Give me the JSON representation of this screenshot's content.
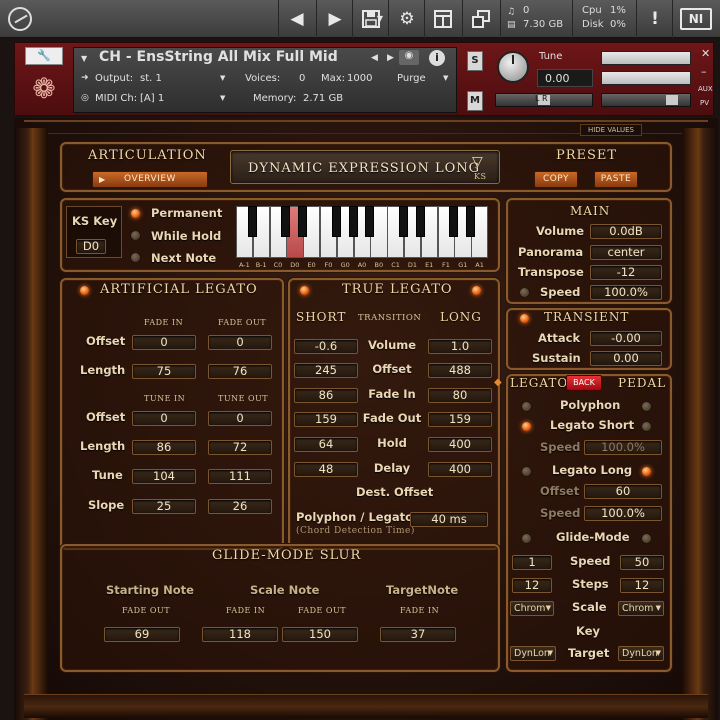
{
  "toolbar": {
    "voices_count": "0",
    "memory": "7.30 GB",
    "cpu_label": "Cpu",
    "cpu_value": "1%",
    "disk_label": "Disk",
    "disk_value": "0%",
    "ni_label": "NI"
  },
  "instrument": {
    "name": "CH - EnsString All Mix Full Mid",
    "output_label": "Output:",
    "output_value": "st. 1",
    "voices_label": "Voices:",
    "voices_value": "0",
    "max_label": "Max:",
    "max_value": "1000",
    "midi_label": "MIDI Ch:",
    "midi_value": "[A]  1",
    "memory_label": "Memory:",
    "memory_value": "2.71 GB",
    "purge_label": "Purge",
    "solo_label": "S",
    "mute_label": "M",
    "tune_label": "Tune",
    "tune_value": "0.00",
    "aux_label": "AUX",
    "pv_label": "PV",
    "lr_label": "L R",
    "hide_values_label": "HIDE VALUES"
  },
  "articulation": {
    "title": "ARTICULATION",
    "overview_button": "OVERVIEW",
    "current": "DYNAMIC EXPRESSION LONG",
    "ks_label": "KS"
  },
  "preset": {
    "title": "PRESET",
    "copy_button": "COPY",
    "paste_button": "PASTE"
  },
  "keyswitch": {
    "ks_key_label": "KS Key",
    "ks_key_value": "D0",
    "modes": [
      {
        "label": "Permanent",
        "on": true
      },
      {
        "label": "While Hold",
        "on": false
      },
      {
        "label": "Next Note",
        "on": false
      }
    ],
    "note_labels": [
      "A-1",
      "B-1",
      "C0",
      "D0",
      "E0",
      "F0",
      "G0",
      "A0",
      "B0",
      "C1",
      "D1",
      "E1",
      "F1",
      "G1",
      "A1"
    ],
    "highlighted_note": "D0"
  },
  "main": {
    "title": "MAIN",
    "rows": [
      {
        "label": "Volume",
        "value": "0.0dB"
      },
      {
        "label": "Panorama",
        "value": "center"
      },
      {
        "label": "Transpose",
        "value": "-12"
      },
      {
        "label": "Speed",
        "value": "100.0%"
      }
    ]
  },
  "transient": {
    "title": "TRANSIENT",
    "attack_label": "Attack",
    "attack_value": "-0.00",
    "sustain_label": "Sustain",
    "sustain_value": "0.00"
  },
  "artificial_legato": {
    "title": "ARTIFICIAL LEGATO",
    "fade_in_header": "FADE IN",
    "fade_out_header": "FADE OUT",
    "tune_in_header": "TUNE IN",
    "tune_out_header": "TUNE OUT",
    "fade_rows": [
      {
        "label": "Offset",
        "in": "0",
        "out": "0"
      },
      {
        "label": "Length",
        "in": "75",
        "out": "76"
      }
    ],
    "tune_rows": [
      {
        "label": "Offset",
        "in": "0",
        "out": "0"
      },
      {
        "label": "Length",
        "in": "86",
        "out": "72"
      },
      {
        "label": "Tune",
        "in": "104",
        "out": "111"
      },
      {
        "label": "Slope",
        "in": "25",
        "out": "26"
      }
    ]
  },
  "true_legato": {
    "title": "TRUE LEGATO",
    "short_header": "SHORT",
    "transition_header": "TRANSITION",
    "long_header": "LONG",
    "rows": [
      {
        "short": "-0.6",
        "label": "Volume",
        "long": "1.0"
      },
      {
        "short": "245",
        "label": "Offset",
        "long": "488"
      },
      {
        "short": "86",
        "label": "Fade In",
        "long": "80"
      },
      {
        "short": "159",
        "label": "Fade Out",
        "long": "159"
      },
      {
        "short": "64",
        "label": "Hold",
        "long": "400"
      },
      {
        "short": "48",
        "label": "Delay",
        "long": "400"
      }
    ],
    "dest_offset_label": "Dest. Offset",
    "polyphon_legato_label": "Polyphon / Legato",
    "chord_detection_label": "(Chord Detection Time)",
    "chord_detection_value": "40 ms"
  },
  "glide_slur": {
    "title": "GLIDE-MODE SLUR",
    "starting_note": {
      "label": "Starting Note",
      "sub": "FADE OUT",
      "value": "69"
    },
    "scale_note": {
      "label": "Scale Note",
      "sub_in": "FADE IN",
      "value_in": "118",
      "sub_out": "FADE OUT",
      "value_out": "150"
    },
    "target_note": {
      "label": "TargetNote",
      "sub": "FADE IN",
      "value": "37"
    }
  },
  "legato_pedal": {
    "legato_label": "LEGATO",
    "back_button": "BACK",
    "pedal_label": "PEDAL",
    "polyphon_label": "Polyphon",
    "legato_short_label": "Legato Short",
    "short_speed_label": "Speed",
    "short_speed_value": "100.0%",
    "legato_long_label": "Legato Long",
    "long_offset_label": "Offset",
    "long_offset_value": "60",
    "long_speed_label": "Speed",
    "long_speed_value": "100.0%",
    "glide_mode_label": "Glide-Mode",
    "speed_label": "Speed",
    "speed_left": "1",
    "speed_right": "50",
    "steps_label": "Steps",
    "steps_left": "12",
    "steps_right": "12",
    "scale_label": "Scale",
    "scale_left": "Chrom",
    "scale_right": "Chrom",
    "key_label": "Key",
    "target_label": "Target",
    "target_left": "DynLon",
    "target_right": "DynLon"
  },
  "colors": {
    "header_red": "#6e1618",
    "gold_text": "#f0d9a8",
    "led_orange": "#e85a10",
    "back_red": "#c8141c",
    "key_highlight": "#e07a7a"
  }
}
